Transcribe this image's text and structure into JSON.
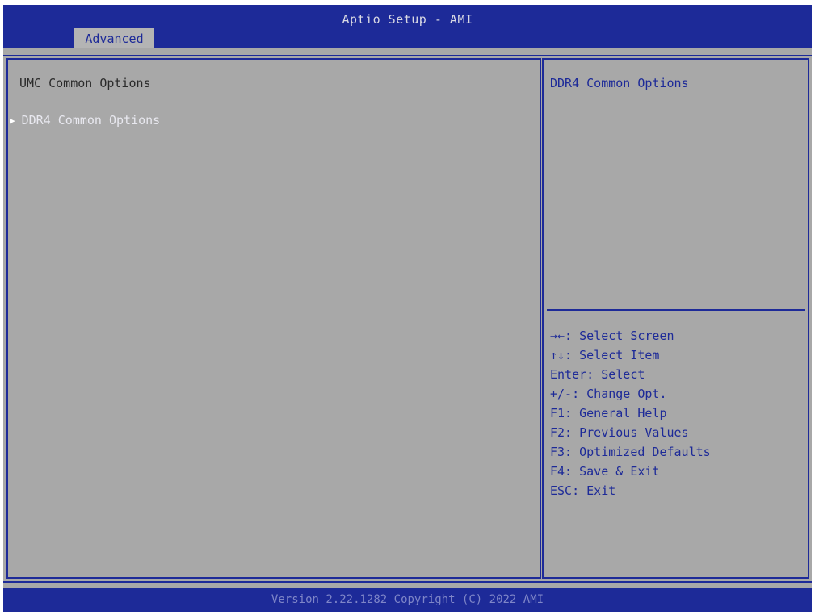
{
  "header": {
    "title": "Aptio Setup - AMI",
    "active_tab": "Advanced"
  },
  "main": {
    "section_title": "UMC Common Options",
    "items": [
      {
        "label": "DDR4 Common Options",
        "submenu": true
      }
    ]
  },
  "help": {
    "description": "DDR4 Common Options",
    "keys": [
      "→←: Select Screen",
      "↑↓: Select Item",
      "Enter: Select",
      "+/-: Change Opt.",
      "F1: General Help",
      "F2: Previous Values",
      "F3: Optimized Defaults",
      "F4: Save & Exit",
      "ESC: Exit"
    ]
  },
  "footer": {
    "version": "Version 2.22.1282 Copyright (C) 2022 AMI"
  },
  "colors": {
    "bios_blue": "#1d2a98",
    "background_gray": "#a8a8a8"
  },
  "icons": {
    "submenu_marker": "submenu-arrow-icon"
  }
}
